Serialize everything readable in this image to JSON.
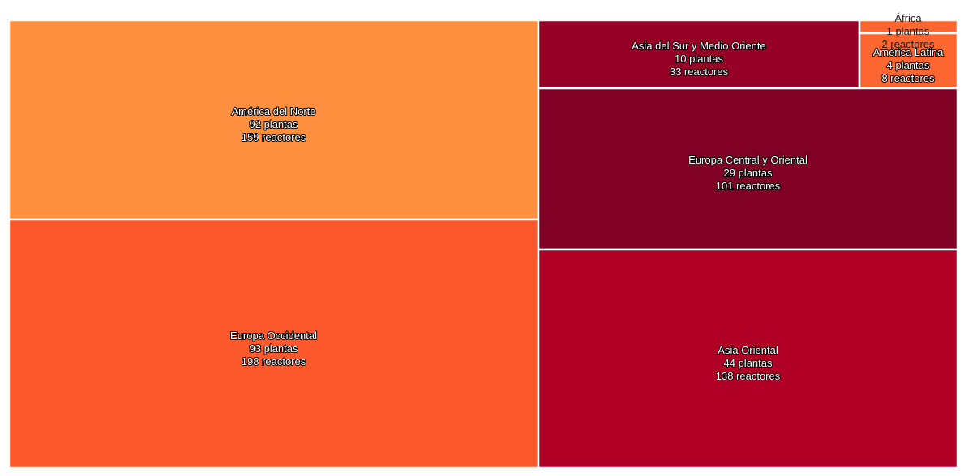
{
  "chart_data": {
    "type": "treemap",
    "title": "",
    "value_field": "reactores",
    "tiles": [
      {
        "label": "América del Norte",
        "lines": [
          "América del Norte",
          "92 plantas",
          "159 reactores"
        ],
        "plantas": 92,
        "reactores": 159,
        "color": "#fe8f3e"
      },
      {
        "label": "Europa Occidental",
        "lines": [
          "Europa Occidental",
          "93 plantas",
          "198 reactores"
        ],
        "plantas": 93,
        "reactores": 198,
        "color": "#fd582c"
      },
      {
        "label": "Asia del Sur y Medio Oriente",
        "lines": [
          "Asia del Sur y Medio Oriente",
          "10 plantas",
          "33 reactores"
        ],
        "plantas": 10,
        "reactores": 33,
        "color": "#970127"
      },
      {
        "label": "África",
        "lines": [
          "África",
          "1 plantas",
          "2 reactores"
        ],
        "plantas": 1,
        "reactores": 2,
        "color": "#fd6531"
      },
      {
        "label": "América Latina",
        "lines": [
          "América Latina",
          "4 plantas",
          "8 reactores"
        ],
        "plantas": 4,
        "reactores": 8,
        "color": "#fd6531"
      },
      {
        "label": "Europa Central y Oriental",
        "lines": [
          "Europa Central y Oriental",
          "29 plantas",
          "101 reactores"
        ],
        "plantas": 29,
        "reactores": 101,
        "color": "#800026"
      },
      {
        "label": "Asia Oriental",
        "lines": [
          "Asia Oriental",
          "44 plantas",
          "138 reactores"
        ],
        "plantas": 44,
        "reactores": 138,
        "color": "#b10026"
      }
    ]
  }
}
